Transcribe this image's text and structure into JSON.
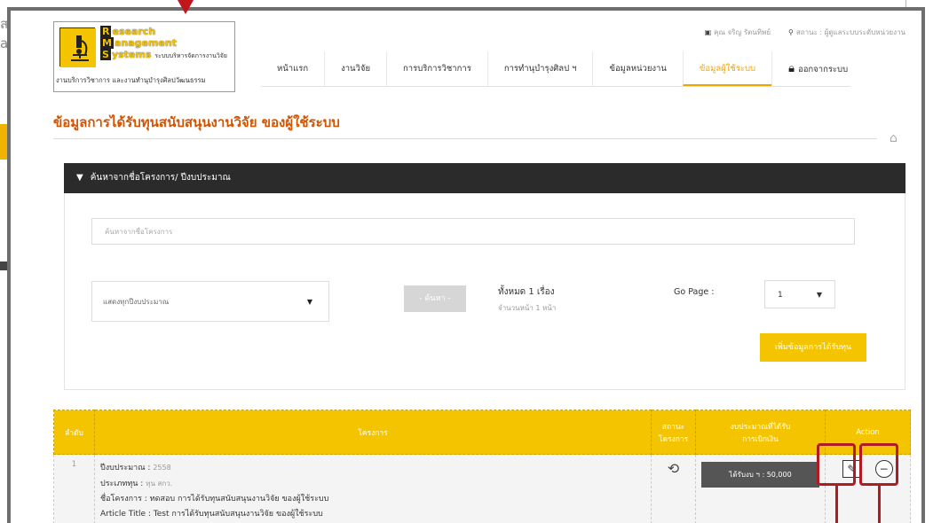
{
  "background": {
    "left_text": "ส\na"
  },
  "header": {
    "logo": {
      "line1": "esearch",
      "line2": "anagement",
      "line3": "ystems",
      "line3_sub": "ระบบบริหารจัดการงานวิจัย",
      "caps": [
        "R",
        "M",
        "S"
      ],
      "bottom": "งานบริการวิชาการ และงานทำนุบำรุงศิลปวัฒนธรรม"
    },
    "user_label": "คุณ จริญ รัตนทิพย์",
    "status_label": "สถานะ : ผู้ดูแลระบบระดับหน่วยงาน"
  },
  "nav": {
    "items": [
      {
        "label": "หน้าแรก"
      },
      {
        "label": "งานวิจัย"
      },
      {
        "label": "การบริการวิชาการ"
      },
      {
        "label": "การทำนุบำรุงศิลป ฯ"
      },
      {
        "label": "ข้อมูลหน่วยงาน"
      },
      {
        "label": "ข้อมูลผู้ใช้ระบบ"
      }
    ],
    "logout_label": "ออกจากระบบ",
    "active_index": 5
  },
  "page": {
    "title": "ข้อมูลการได้รับทุนสนับสนุนงานวิจัย ของผู้ใช้ระบบ"
  },
  "search": {
    "panel_title": "ค้นหาจากชื่อโครงการ/ ปีงบประมาณ",
    "input_placeholder": "ค้นหาจากชื่อโครงการ",
    "year_select_value": "แสดงทุกปีงบประมาณ",
    "search_button": "- ค้นหา -",
    "total_label": "ทั้งหมด 1 เรื่อง",
    "pages_label": "จำนวนหน้า 1 หน้า",
    "gopage_label": "Go Page :",
    "gopage_value": "1",
    "add_button": "เพิ่มข้อมูลการได้รับทุน"
  },
  "table": {
    "headers": {
      "index": "ลำดับ",
      "project": "โครงการ",
      "status_l1": "สถานะ",
      "status_l2": "โครงการ",
      "budget_l1": "งบประมาณที่ได้รับ",
      "budget_l2": "การเบิกเงิน",
      "action": "Action"
    },
    "rows": [
      {
        "index": "1",
        "fiscal_year_label": "ปีงบประมาณ :",
        "fiscal_year": "2558",
        "fund_type_label": "ประเภททุน :",
        "fund_type": "ทุน สกว.",
        "project_name_label": "ชื่อโครงการ :",
        "project_name": "ทดสอบ การได้รับทุนสนับสนุนงานวิจัย ของผู้ใช้ระบบ",
        "article_title_label": "Article Title :",
        "article_title": "Test การได้รับทุนสนับสนุนงานวิจัย ของผู้ใช้ระบบ",
        "budget": "ได้รับงบ ฯ : 50,000"
      }
    ]
  },
  "colors": {
    "accent": "#f5c400",
    "title": "#d35400",
    "highlight": "#b01c22"
  }
}
